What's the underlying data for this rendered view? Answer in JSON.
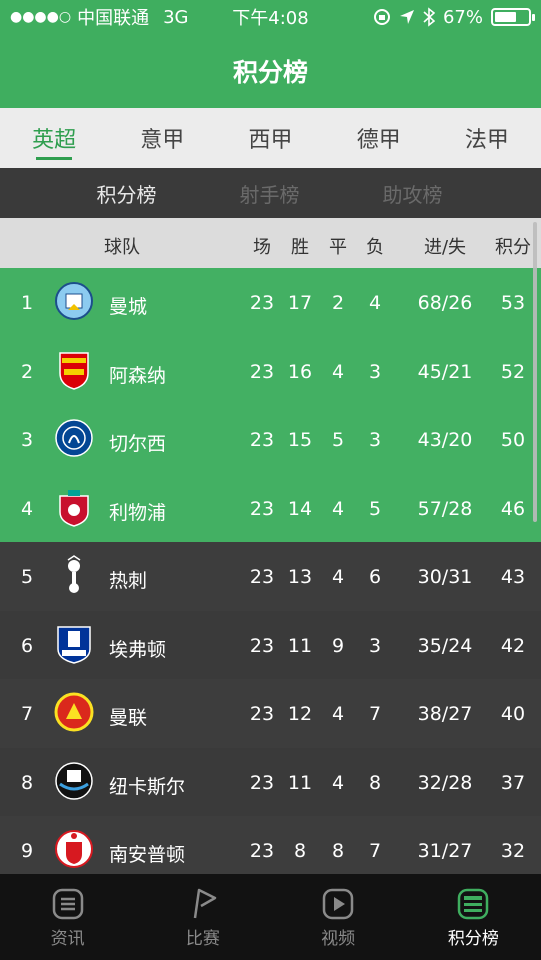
{
  "status": {
    "signal": "●●●●○",
    "carrier": "中国联通",
    "network": "3G",
    "time": "下午4:08",
    "battery_text": "67%",
    "battery_level": 0.67
  },
  "nav": {
    "title": "积分榜"
  },
  "league_tabs": [
    {
      "label": "英超",
      "active": true
    },
    {
      "label": "意甲",
      "active": false
    },
    {
      "label": "西甲",
      "active": false
    },
    {
      "label": "德甲",
      "active": false
    },
    {
      "label": "法甲",
      "active": false
    }
  ],
  "sub_tabs": [
    {
      "label": "积分榜",
      "active": true
    },
    {
      "label": "射手榜",
      "active": false
    },
    {
      "label": "助攻榜",
      "active": false
    }
  ],
  "table": {
    "headers": {
      "team": "球队",
      "played": "场",
      "won": "胜",
      "drawn": "平",
      "lost": "负",
      "goals": "进/失",
      "points": "积分"
    },
    "rows": [
      {
        "rank": "1",
        "team": "曼城",
        "crest": "man-city-crest",
        "played": "23",
        "won": "17",
        "drawn": "2",
        "lost": "4",
        "goals": "68/26",
        "points": "53"
      },
      {
        "rank": "2",
        "team": "阿森纳",
        "crest": "arsenal-crest",
        "played": "23",
        "won": "16",
        "drawn": "4",
        "lost": "3",
        "goals": "45/21",
        "points": "52"
      },
      {
        "rank": "3",
        "team": "切尔西",
        "crest": "chelsea-crest",
        "played": "23",
        "won": "15",
        "drawn": "5",
        "lost": "3",
        "goals": "43/20",
        "points": "50"
      },
      {
        "rank": "4",
        "team": "利物浦",
        "crest": "liverpool-crest",
        "played": "23",
        "won": "14",
        "drawn": "4",
        "lost": "5",
        "goals": "57/28",
        "points": "46"
      },
      {
        "rank": "5",
        "team": "热刺",
        "crest": "tottenham-crest",
        "played": "23",
        "won": "13",
        "drawn": "4",
        "lost": "6",
        "goals": "30/31",
        "points": "43"
      },
      {
        "rank": "6",
        "team": "埃弗顿",
        "crest": "everton-crest",
        "played": "23",
        "won": "11",
        "drawn": "9",
        "lost": "3",
        "goals": "35/24",
        "points": "42"
      },
      {
        "rank": "7",
        "team": "曼联",
        "crest": "man-utd-crest",
        "played": "23",
        "won": "12",
        "drawn": "4",
        "lost": "7",
        "goals": "38/27",
        "points": "40"
      },
      {
        "rank": "8",
        "team": "纽卡斯尔",
        "crest": "newcastle-crest",
        "played": "23",
        "won": "11",
        "drawn": "4",
        "lost": "8",
        "goals": "32/28",
        "points": "37"
      },
      {
        "rank": "9",
        "team": "南安普顿",
        "crest": "southampton-crest",
        "played": "23",
        "won": "8",
        "drawn": "8",
        "lost": "7",
        "goals": "31/27",
        "points": "32"
      }
    ]
  },
  "tabbar": [
    {
      "label": "资讯",
      "icon": "news-icon",
      "active": false
    },
    {
      "label": "比赛",
      "icon": "match-icon",
      "active": false
    },
    {
      "label": "视频",
      "icon": "video-icon",
      "active": false
    },
    {
      "label": "积分榜",
      "icon": "standings-icon",
      "active": true
    }
  ],
  "colors": {
    "accent": "#3fae5f",
    "highlight_rows": "#43b063",
    "dark_rows": "#3d3d3d"
  }
}
